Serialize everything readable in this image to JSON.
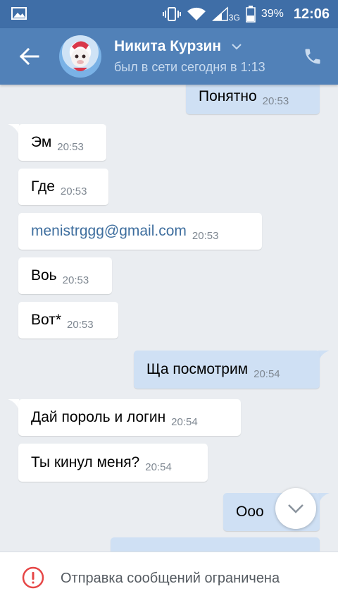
{
  "status_bar": {
    "battery": "39%",
    "network": "3G",
    "time": "12:06"
  },
  "header": {
    "name": "Никита Курзин",
    "status": "был в сети сегодня в 1:13"
  },
  "messages": [
    {
      "text": "Понятно",
      "time": "20:53",
      "dir": "out"
    },
    {
      "text": "Эм",
      "time": "20:53",
      "dir": "in"
    },
    {
      "text": "Где",
      "time": "20:53",
      "dir": "in"
    },
    {
      "text": "menistrggg@gmail.com",
      "time": "20:53",
      "dir": "in"
    },
    {
      "text": "Воь",
      "time": "20:53",
      "dir": "in"
    },
    {
      "text": "Вот*",
      "time": "20:53",
      "dir": "in"
    },
    {
      "text": "Ща посмотрим",
      "time": "20:54",
      "dir": "out"
    },
    {
      "text": "Дай пороль и логин",
      "time": "20:54",
      "dir": "in"
    },
    {
      "text": "Ты кинул меня?",
      "time": "20:54",
      "dir": "in"
    },
    {
      "text": "Ооо",
      "time": "",
      "dir": "out"
    }
  ],
  "footer": {
    "notice": "Отправка сообщений ограничена"
  },
  "colors": {
    "header": "#5181b8",
    "status_bar": "#3f6ea7",
    "outgoing": "#cfe0f4",
    "incoming": "#ffffff",
    "background": "#eaedf1",
    "warning": "#e64646"
  }
}
